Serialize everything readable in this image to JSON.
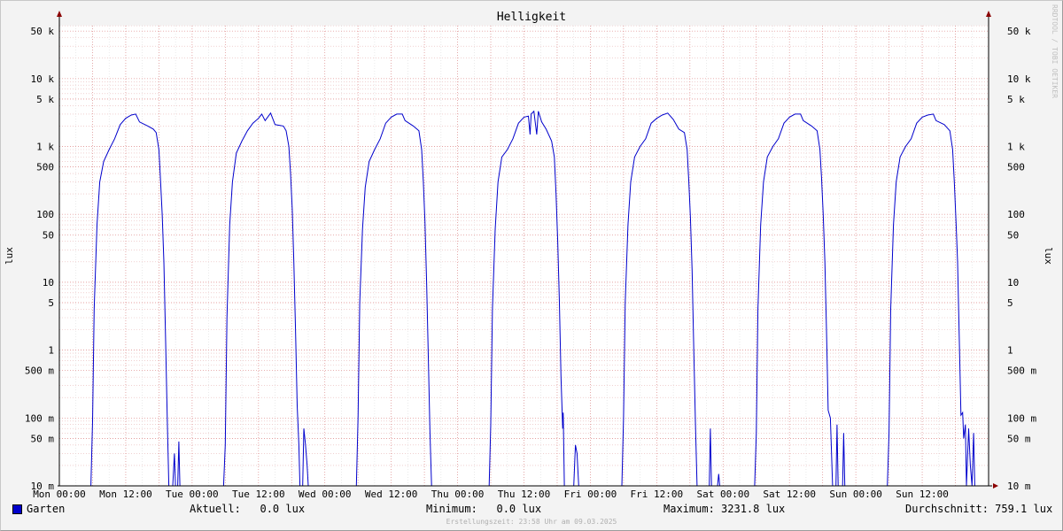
{
  "chart_data": {
    "type": "line",
    "title": "Helligkeit",
    "ylabel": "lux",
    "ylabel_right": "lux",
    "y_scale": "log",
    "ylim": [
      10,
      60000
    ],
    "y_ticks": [
      {
        "value": 10,
        "label": "10 m"
      },
      {
        "value": 50,
        "label": "50 m"
      },
      {
        "value": 100,
        "label": "100 m"
      },
      {
        "value": 500,
        "label": "500 m"
      },
      {
        "value": 1000,
        "label": "1"
      },
      {
        "value": 5000,
        "label": "5"
      },
      {
        "value": 10000,
        "label": "10"
      },
      {
        "value": 50000,
        "label": "50"
      },
      {
        "value": 100000,
        "label": "100"
      },
      {
        "value": 500000,
        "label": "500"
      },
      {
        "value": 1000000,
        "label": "1 k"
      },
      {
        "value": 5000000,
        "label": "5 k"
      },
      {
        "value": 10000000,
        "label": "10 k"
      },
      {
        "value": 50000000,
        "label": "50 k"
      }
    ],
    "y_units_note": "values in millilux",
    "x_unit": "hours",
    "xlim": [
      0,
      168
    ],
    "x_tick_labels": [
      "Mon 00:00",
      "Mon 12:00",
      "Tue 00:00",
      "Tue 12:00",
      "Wed 00:00",
      "Wed 12:00",
      "Thu 00:00",
      "Thu 12:00",
      "Fri 00:00",
      "Fri 12:00",
      "Sat 00:00",
      "Sat 12:00",
      "Sun 00:00",
      "Sun 12:00"
    ],
    "grid": true,
    "series": [
      {
        "name": "Garten",
        "color": "#0000cc",
        "points": [
          [
            0,
            10
          ],
          [
            5.7,
            10
          ],
          [
            6.0,
            90
          ],
          [
            6.3,
            4000
          ],
          [
            6.8,
            70000
          ],
          [
            7.3,
            300000
          ],
          [
            8,
            600000
          ],
          [
            9,
            900000
          ],
          [
            10,
            1300000
          ],
          [
            11,
            2100000
          ],
          [
            12,
            2600000
          ],
          [
            13,
            2900000
          ],
          [
            13.8,
            3000000
          ],
          [
            14.5,
            2300000
          ],
          [
            16,
            2000000
          ],
          [
            17,
            1800000
          ],
          [
            17.5,
            1600000
          ],
          [
            18,
            900000
          ],
          [
            18.3,
            300000
          ],
          [
            18.6,
            100000
          ],
          [
            18.9,
            20000
          ],
          [
            19.2,
            1500
          ],
          [
            19.5,
            100
          ],
          [
            19.8,
            10
          ],
          [
            20.5,
            10
          ],
          [
            20.8,
            30
          ],
          [
            21,
            10
          ],
          [
            21.4,
            10
          ],
          [
            21.6,
            45
          ],
          [
            21.8,
            10
          ],
          [
            29.7,
            10
          ],
          [
            30.0,
            40
          ],
          [
            30.3,
            3000
          ],
          [
            30.8,
            70000
          ],
          [
            31.3,
            300000
          ],
          [
            32,
            800000
          ],
          [
            33,
            1200000
          ],
          [
            34,
            1700000
          ],
          [
            35,
            2200000
          ],
          [
            36,
            2600000
          ],
          [
            36.6,
            3000000
          ],
          [
            37.2,
            2400000
          ],
          [
            38.2,
            3100000
          ],
          [
            39,
            2100000
          ],
          [
            40.5,
            2000000
          ],
          [
            41,
            1700000
          ],
          [
            41.5,
            1000000
          ],
          [
            41.8,
            400000
          ],
          [
            42.1,
            120000
          ],
          [
            42.4,
            20000
          ],
          [
            42.7,
            2000
          ],
          [
            43,
            150
          ],
          [
            43.3,
            40
          ],
          [
            43.5,
            10
          ],
          [
            44,
            10
          ],
          [
            44.2,
            70
          ],
          [
            44.5,
            40
          ],
          [
            44.8,
            20
          ],
          [
            45,
            10
          ],
          [
            53.7,
            10
          ],
          [
            54.0,
            100
          ],
          [
            54.3,
            5000
          ],
          [
            54.8,
            60000
          ],
          [
            55.3,
            250000
          ],
          [
            56,
            600000
          ],
          [
            57,
            900000
          ],
          [
            58,
            1300000
          ],
          [
            59,
            2200000
          ],
          [
            60,
            2700000
          ],
          [
            61,
            3000000
          ],
          [
            62,
            3000000
          ],
          [
            62.5,
            2400000
          ],
          [
            64,
            2000000
          ],
          [
            65,
            1700000
          ],
          [
            65.5,
            900000
          ],
          [
            65.8,
            300000
          ],
          [
            66.1,
            80000
          ],
          [
            66.4,
            10000
          ],
          [
            66.7,
            800
          ],
          [
            67,
            60
          ],
          [
            67.3,
            10
          ],
          [
            77.7,
            10
          ],
          [
            78.0,
            80
          ],
          [
            78.3,
            4000
          ],
          [
            78.8,
            60000
          ],
          [
            79.3,
            300000
          ],
          [
            80,
            700000
          ],
          [
            81,
            900000
          ],
          [
            82,
            1300000
          ],
          [
            83,
            2200000
          ],
          [
            84,
            2700000
          ],
          [
            84.8,
            2800000
          ],
          [
            85.1,
            1500000
          ],
          [
            85.3,
            3000000
          ],
          [
            85.8,
            3300000
          ],
          [
            86.3,
            1500000
          ],
          [
            86.6,
            3300000
          ],
          [
            87.2,
            2300000
          ],
          [
            88,
            1800000
          ],
          [
            89,
            1200000
          ],
          [
            89.5,
            700000
          ],
          [
            89.8,
            200000
          ],
          [
            90.1,
            40000
          ],
          [
            90.4,
            5000
          ],
          [
            90.7,
            400
          ],
          [
            91,
            70
          ],
          [
            91.1,
            120
          ],
          [
            91.3,
            10
          ],
          [
            93,
            10
          ],
          [
            93.3,
            40
          ],
          [
            93.6,
            30
          ],
          [
            93.9,
            10
          ],
          [
            101.7,
            10
          ],
          [
            102.0,
            100
          ],
          [
            102.3,
            5000
          ],
          [
            102.8,
            70000
          ],
          [
            103.3,
            300000
          ],
          [
            104,
            700000
          ],
          [
            105,
            1000000
          ],
          [
            106,
            1300000
          ],
          [
            107,
            2200000
          ],
          [
            108,
            2600000
          ],
          [
            109,
            2900000
          ],
          [
            110,
            3100000
          ],
          [
            111,
            2500000
          ],
          [
            112,
            1800000
          ],
          [
            113,
            1600000
          ],
          [
            113.5,
            900000
          ],
          [
            113.8,
            300000
          ],
          [
            114.1,
            90000
          ],
          [
            114.4,
            15000
          ],
          [
            114.7,
            1000
          ],
          [
            115,
            80
          ],
          [
            115.3,
            10
          ],
          [
            117.5,
            10
          ],
          [
            117.7,
            70
          ],
          [
            117.9,
            10
          ],
          [
            119,
            10
          ],
          [
            119.2,
            15
          ],
          [
            119.4,
            10
          ],
          [
            125.7,
            10
          ],
          [
            126.0,
            60
          ],
          [
            126.3,
            4000
          ],
          [
            126.8,
            70000
          ],
          [
            127.3,
            300000
          ],
          [
            128,
            700000
          ],
          [
            129,
            1000000
          ],
          [
            130,
            1300000
          ],
          [
            131,
            2200000
          ],
          [
            132,
            2700000
          ],
          [
            133,
            3000000
          ],
          [
            134,
            3000000
          ],
          [
            134.5,
            2400000
          ],
          [
            136,
            2000000
          ],
          [
            137,
            1700000
          ],
          [
            137.5,
            900000
          ],
          [
            137.8,
            350000
          ],
          [
            138.1,
            100000
          ],
          [
            138.4,
            20000
          ],
          [
            138.7,
            2000
          ],
          [
            139,
            130
          ],
          [
            139.4,
            100
          ],
          [
            139.8,
            10
          ],
          [
            140.4,
            10
          ],
          [
            140.6,
            80
          ],
          [
            140.8,
            10
          ],
          [
            141.6,
            10
          ],
          [
            141.8,
            60
          ],
          [
            142,
            10
          ],
          [
            149.7,
            10
          ],
          [
            150.0,
            60
          ],
          [
            150.3,
            4000
          ],
          [
            150.8,
            70000
          ],
          [
            151.3,
            300000
          ],
          [
            152,
            700000
          ],
          [
            153,
            1000000
          ],
          [
            154,
            1300000
          ],
          [
            155,
            2200000
          ],
          [
            156,
            2700000
          ],
          [
            157,
            2900000
          ],
          [
            158,
            3000000
          ],
          [
            158.5,
            2400000
          ],
          [
            160,
            2100000
          ],
          [
            161,
            1700000
          ],
          [
            161.5,
            900000
          ],
          [
            161.8,
            300000
          ],
          [
            162.1,
            80000
          ],
          [
            162.4,
            20000
          ],
          [
            162.7,
            1500
          ],
          [
            163,
            110
          ],
          [
            163.3,
            120
          ],
          [
            163.5,
            50
          ],
          [
            163.8,
            80
          ],
          [
            164.0,
            10
          ],
          [
            164.4,
            70
          ],
          [
            164.7,
            20
          ],
          [
            165,
            10
          ],
          [
            165.3,
            60
          ],
          [
            165.5,
            10
          ],
          [
            168,
            10
          ]
        ]
      }
    ],
    "side_label": "RRDTOOL / TOBI OETIKER"
  },
  "legend": {
    "series_name": "Garten",
    "current": "Aktuell:   0.0 lux",
    "minimum": "Minimum:   0.0 lux",
    "maximum": "Maximum: 3231.8 lux",
    "average": "Durchschnitt: 759.1 lux"
  },
  "footer": {
    "generated": "Erstellungszeit: 23:58 Uhr am 09.03.2025"
  }
}
